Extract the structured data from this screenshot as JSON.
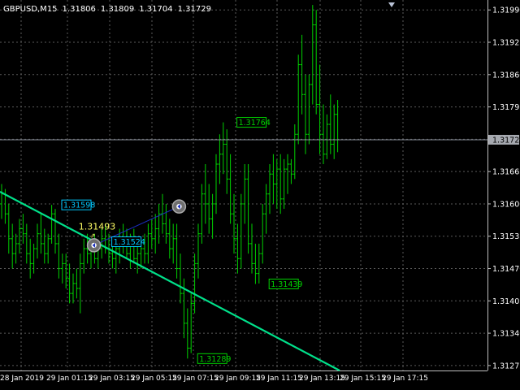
{
  "header": {
    "symbol": "GBPUSD,M15",
    "open": "1.31806",
    "high": "1.31809",
    "low": "1.31704",
    "close": "1.31729"
  },
  "colors": {
    "background": "#000000",
    "grid": "#5a5a5a",
    "bull_bar": "#00d200",
    "bear_bar": "#00d200",
    "current_price_line": "#8a8f9c",
    "trend_line": "#00e08a",
    "connector_line": "#1b2fbf",
    "cyan_label": "#00c8ff",
    "green_label": "#00d200",
    "yellow_label": "#ffff66",
    "price_tag_bg": "#a6a9b0"
  },
  "price_axis": {
    "labels": [
      "1.31990",
      "1.31925",
      "1.31860",
      "1.31795",
      "1.31730",
      "1.31665",
      "1.31600",
      "1.31535",
      "1.31470",
      "1.31405",
      "1.31340",
      "1.31275"
    ],
    "current_price": "1.31729"
  },
  "time_axis": {
    "labels": [
      "28 Jan 2019",
      "29 Jan 01:15",
      "29 Jan 03:15",
      "29 Jan 05:15",
      "29 Jan 07:15",
      "29 Jan 09:15",
      "29 Jan 11:15",
      "29 Jan 13:15",
      "29 Jan 15:15",
      "29 Jan 17:15"
    ]
  },
  "annotations": {
    "labels": [
      {
        "text": "1.31598",
        "style": "cyan",
        "price": 1.31598,
        "bar": 15
      },
      {
        "text": "1.31524",
        "style": "cyan",
        "price": 1.31524,
        "bar": 29
      },
      {
        "text": "1.31764",
        "style": "green",
        "price": 1.31764,
        "bar": 64
      },
      {
        "text": "1.31439",
        "style": "green",
        "price": 1.31439,
        "bar": 73
      },
      {
        "text": "1.31289",
        "style": "green",
        "price": 1.31289,
        "bar": 53
      }
    ],
    "yellow_text": "1.31493",
    "yellow_price": 1.31493,
    "yellow_bar": 22,
    "markers": [
      {
        "bar": 24,
        "price": 1.3152
      },
      {
        "bar": 46,
        "price": 1.31598
      }
    ]
  },
  "chart_data": {
    "type": "ohlc",
    "xlabels": [
      "28 Jan 2019",
      "29 Jan 01:15",
      "29 Jan 03:15",
      "29 Jan 05:15",
      "29 Jan 07:15",
      "29 Jan 09:15",
      "29 Jan 11:15",
      "29 Jan 13:15",
      "29 Jan 15:15",
      "29 Jan 17:15"
    ],
    "ylim": [
      1.31265,
      1.3201
    ],
    "grid": true,
    "price_ticks": [
      1.3199,
      1.31925,
      1.3186,
      1.31795,
      1.3173,
      1.31665,
      1.316,
      1.31535,
      1.3147,
      1.31405,
      1.3134,
      1.31275
    ],
    "bars": [
      {
        "o": 1.316,
        "h": 1.3164,
        "l": 1.3157,
        "c": 1.3162
      },
      {
        "o": 1.3162,
        "h": 1.3163,
        "l": 1.3156,
        "c": 1.3158
      },
      {
        "o": 1.3158,
        "h": 1.316,
        "l": 1.315,
        "c": 1.3153
      },
      {
        "o": 1.3153,
        "h": 1.3156,
        "l": 1.3147,
        "c": 1.315
      },
      {
        "o": 1.315,
        "h": 1.3154,
        "l": 1.3148,
        "c": 1.3152
      },
      {
        "o": 1.3152,
        "h": 1.3157,
        "l": 1.315,
        "c": 1.3155
      },
      {
        "o": 1.3155,
        "h": 1.3158,
        "l": 1.3152,
        "c": 1.3154
      },
      {
        "o": 1.3154,
        "h": 1.3156,
        "l": 1.3148,
        "c": 1.315
      },
      {
        "o": 1.315,
        "h": 1.3153,
        "l": 1.3145,
        "c": 1.3148
      },
      {
        "o": 1.3148,
        "h": 1.3152,
        "l": 1.3146,
        "c": 1.3151
      },
      {
        "o": 1.3151,
        "h": 1.3156,
        "l": 1.3149,
        "c": 1.3154
      },
      {
        "o": 1.3154,
        "h": 1.3158,
        "l": 1.315,
        "c": 1.3152
      },
      {
        "o": 1.3152,
        "h": 1.3155,
        "l": 1.3148,
        "c": 1.315
      },
      {
        "o": 1.315,
        "h": 1.3154,
        "l": 1.3148,
        "c": 1.3153
      },
      {
        "o": 1.3153,
        "h": 1.31598,
        "l": 1.3152,
        "c": 1.3158
      },
      {
        "o": 1.3158,
        "h": 1.3159,
        "l": 1.315,
        "c": 1.3152
      },
      {
        "o": 1.3152,
        "h": 1.3154,
        "l": 1.3145,
        "c": 1.3147
      },
      {
        "o": 1.3147,
        "h": 1.315,
        "l": 1.3144,
        "c": 1.3148
      },
      {
        "o": 1.3148,
        "h": 1.315,
        "l": 1.3143,
        "c": 1.3145
      },
      {
        "o": 1.3145,
        "h": 1.3148,
        "l": 1.314,
        "c": 1.3142
      },
      {
        "o": 1.3142,
        "h": 1.3146,
        "l": 1.314,
        "c": 1.3144
      },
      {
        "o": 1.3144,
        "h": 1.3147,
        "l": 1.3141,
        "c": 1.3143
      },
      {
        "o": 1.3143,
        "h": 1.315,
        "l": 1.3138,
        "c": 1.3148
      },
      {
        "o": 1.3148,
        "h": 1.3153,
        "l": 1.3146,
        "c": 1.3151
      },
      {
        "o": 1.3151,
        "h": 1.3154,
        "l": 1.3148,
        "c": 1.315
      },
      {
        "o": 1.315,
        "h": 1.3153,
        "l": 1.3147,
        "c": 1.3152
      },
      {
        "o": 1.3152,
        "h": 1.3154,
        "l": 1.3148,
        "c": 1.3149
      },
      {
        "o": 1.3149,
        "h": 1.3152,
        "l": 1.3147,
        "c": 1.3151
      },
      {
        "o": 1.3151,
        "h": 1.3155,
        "l": 1.3149,
        "c": 1.3153
      },
      {
        "o": 1.3153,
        "h": 1.3156,
        "l": 1.315,
        "c": 1.3151
      },
      {
        "o": 1.3151,
        "h": 1.3154,
        "l": 1.3148,
        "c": 1.315
      },
      {
        "o": 1.315,
        "h": 1.3153,
        "l": 1.3147,
        "c": 1.3149
      },
      {
        "o": 1.3149,
        "h": 1.3152,
        "l": 1.3146,
        "c": 1.3151
      },
      {
        "o": 1.3151,
        "h": 1.3155,
        "l": 1.3148,
        "c": 1.3153
      },
      {
        "o": 1.3153,
        "h": 1.3156,
        "l": 1.315,
        "c": 1.3152
      },
      {
        "o": 1.3152,
        "h": 1.3155,
        "l": 1.3149,
        "c": 1.315
      },
      {
        "o": 1.315,
        "h": 1.3154,
        "l": 1.3147,
        "c": 1.3152
      },
      {
        "o": 1.3152,
        "h": 1.3155,
        "l": 1.3148,
        "c": 1.3149
      },
      {
        "o": 1.3149,
        "h": 1.3152,
        "l": 1.3146,
        "c": 1.315
      },
      {
        "o": 1.315,
        "h": 1.3153,
        "l": 1.3147,
        "c": 1.3151
      },
      {
        "o": 1.3151,
        "h": 1.3154,
        "l": 1.3148,
        "c": 1.315
      },
      {
        "o": 1.315,
        "h": 1.3156,
        "l": 1.3148,
        "c": 1.3154
      },
      {
        "o": 1.3154,
        "h": 1.3157,
        "l": 1.3151,
        "c": 1.3153
      },
      {
        "o": 1.3153,
        "h": 1.3158,
        "l": 1.315,
        "c": 1.3155
      },
      {
        "o": 1.3155,
        "h": 1.316,
        "l": 1.3152,
        "c": 1.3158
      },
      {
        "o": 1.3158,
        "h": 1.3162,
        "l": 1.3154,
        "c": 1.3156
      },
      {
        "o": 1.3156,
        "h": 1.316,
        "l": 1.3152,
        "c": 1.3154
      },
      {
        "o": 1.3154,
        "h": 1.3157,
        "l": 1.3149,
        "c": 1.3151
      },
      {
        "o": 1.3151,
        "h": 1.3156,
        "l": 1.3148,
        "c": 1.3153
      },
      {
        "o": 1.3153,
        "h": 1.3156,
        "l": 1.3145,
        "c": 1.3147
      },
      {
        "o": 1.3147,
        "h": 1.315,
        "l": 1.314,
        "c": 1.3142
      },
      {
        "o": 1.3142,
        "h": 1.3145,
        "l": 1.3133,
        "c": 1.3136
      },
      {
        "o": 1.3136,
        "h": 1.3139,
        "l": 1.31289,
        "c": 1.3131
      },
      {
        "o": 1.3131,
        "h": 1.3142,
        "l": 1.313,
        "c": 1.314
      },
      {
        "o": 1.314,
        "h": 1.315,
        "l": 1.3138,
        "c": 1.3148
      },
      {
        "o": 1.3148,
        "h": 1.3156,
        "l": 1.3145,
        "c": 1.3154
      },
      {
        "o": 1.3154,
        "h": 1.3164,
        "l": 1.3152,
        "c": 1.3162
      },
      {
        "o": 1.3162,
        "h": 1.3168,
        "l": 1.3156,
        "c": 1.316
      },
      {
        "o": 1.316,
        "h": 1.3164,
        "l": 1.3154,
        "c": 1.3157
      },
      {
        "o": 1.3157,
        "h": 1.3162,
        "l": 1.3153,
        "c": 1.316
      },
      {
        "o": 1.316,
        "h": 1.317,
        "l": 1.3158,
        "c": 1.3168
      },
      {
        "o": 1.3168,
        "h": 1.3174,
        "l": 1.3164,
        "c": 1.317
      },
      {
        "o": 1.317,
        "h": 1.31764,
        "l": 1.3166,
        "c": 1.3172
      },
      {
        "o": 1.3172,
        "h": 1.3175,
        "l": 1.3162,
        "c": 1.3165
      },
      {
        "o": 1.3165,
        "h": 1.317,
        "l": 1.3156,
        "c": 1.3158
      },
      {
        "o": 1.3158,
        "h": 1.3162,
        "l": 1.315,
        "c": 1.3153
      },
      {
        "o": 1.3153,
        "h": 1.3156,
        "l": 1.3146,
        "c": 1.3149
      },
      {
        "o": 1.3149,
        "h": 1.3162,
        "l": 1.3147,
        "c": 1.316
      },
      {
        "o": 1.316,
        "h": 1.3168,
        "l": 1.3156,
        "c": 1.3165
      },
      {
        "o": 1.3165,
        "h": 1.3168,
        "l": 1.315,
        "c": 1.3152
      },
      {
        "o": 1.3152,
        "h": 1.3156,
        "l": 1.3146,
        "c": 1.3148
      },
      {
        "o": 1.3148,
        "h": 1.3152,
        "l": 1.31439,
        "c": 1.3146
      },
      {
        "o": 1.3146,
        "h": 1.3152,
        "l": 1.3144,
        "c": 1.315
      },
      {
        "o": 1.315,
        "h": 1.316,
        "l": 1.3148,
        "c": 1.3158
      },
      {
        "o": 1.3158,
        "h": 1.3164,
        "l": 1.3154,
        "c": 1.3162
      },
      {
        "o": 1.3162,
        "h": 1.3168,
        "l": 1.3158,
        "c": 1.3166
      },
      {
        "o": 1.3166,
        "h": 1.317,
        "l": 1.316,
        "c": 1.3164
      },
      {
        "o": 1.3164,
        "h": 1.3169,
        "l": 1.3159,
        "c": 1.3167
      },
      {
        "o": 1.3167,
        "h": 1.317,
        "l": 1.3158,
        "c": 1.3161
      },
      {
        "o": 1.3161,
        "h": 1.3169,
        "l": 1.3159,
        "c": 1.3167
      },
      {
        "o": 1.3167,
        "h": 1.317,
        "l": 1.3162,
        "c": 1.3168
      },
      {
        "o": 1.3168,
        "h": 1.3169,
        "l": 1.3164,
        "c": 1.3166
      },
      {
        "o": 1.3166,
        "h": 1.3176,
        "l": 1.3165,
        "c": 1.3174
      },
      {
        "o": 1.3174,
        "h": 1.319,
        "l": 1.3172,
        "c": 1.3188
      },
      {
        "o": 1.3188,
        "h": 1.3194,
        "l": 1.3178,
        "c": 1.3182
      },
      {
        "o": 1.3182,
        "h": 1.3186,
        "l": 1.317,
        "c": 1.3174
      },
      {
        "o": 1.3174,
        "h": 1.3186,
        "l": 1.3172,
        "c": 1.3184
      },
      {
        "o": 1.3184,
        "h": 1.32,
        "l": 1.318,
        "c": 1.3196
      },
      {
        "o": 1.3196,
        "h": 1.3199,
        "l": 1.3178,
        "c": 1.318
      },
      {
        "o": 1.318,
        "h": 1.3188,
        "l": 1.317,
        "c": 1.3174
      },
      {
        "o": 1.3174,
        "h": 1.318,
        "l": 1.3168,
        "c": 1.317
      },
      {
        "o": 1.317,
        "h": 1.3178,
        "l": 1.3169,
        "c": 1.3176
      },
      {
        "o": 1.3176,
        "h": 1.3182,
        "l": 1.317,
        "c": 1.3172
      },
      {
        "o": 1.3172,
        "h": 1.318,
        "l": 1.3169,
        "c": 1.3178
      },
      {
        "o": 1.3178,
        "h": 1.31809,
        "l": 1.31704,
        "c": 1.31729
      }
    ]
  }
}
